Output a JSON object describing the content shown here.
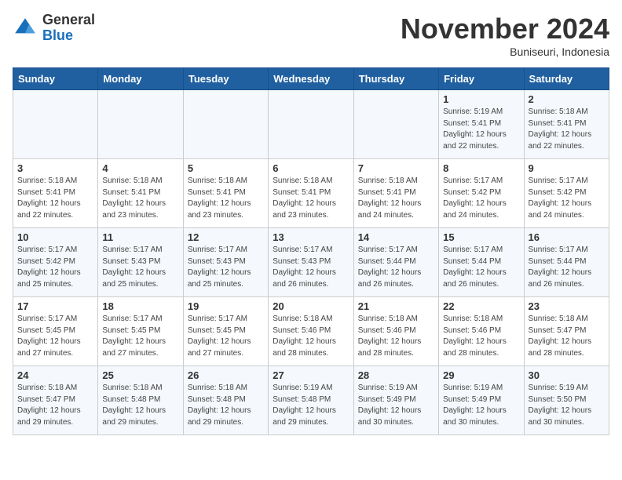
{
  "logo": {
    "general": "General",
    "blue": "Blue"
  },
  "header": {
    "month": "November 2024",
    "location": "Buniseuri, Indonesia"
  },
  "weekdays": [
    "Sunday",
    "Monday",
    "Tuesday",
    "Wednesday",
    "Thursday",
    "Friday",
    "Saturday"
  ],
  "weeks": [
    [
      {
        "day": "",
        "info": ""
      },
      {
        "day": "",
        "info": ""
      },
      {
        "day": "",
        "info": ""
      },
      {
        "day": "",
        "info": ""
      },
      {
        "day": "",
        "info": ""
      },
      {
        "day": "1",
        "info": "Sunrise: 5:19 AM\nSunset: 5:41 PM\nDaylight: 12 hours\nand 22 minutes."
      },
      {
        "day": "2",
        "info": "Sunrise: 5:18 AM\nSunset: 5:41 PM\nDaylight: 12 hours\nand 22 minutes."
      }
    ],
    [
      {
        "day": "3",
        "info": "Sunrise: 5:18 AM\nSunset: 5:41 PM\nDaylight: 12 hours\nand 22 minutes."
      },
      {
        "day": "4",
        "info": "Sunrise: 5:18 AM\nSunset: 5:41 PM\nDaylight: 12 hours\nand 23 minutes."
      },
      {
        "day": "5",
        "info": "Sunrise: 5:18 AM\nSunset: 5:41 PM\nDaylight: 12 hours\nand 23 minutes."
      },
      {
        "day": "6",
        "info": "Sunrise: 5:18 AM\nSunset: 5:41 PM\nDaylight: 12 hours\nand 23 minutes."
      },
      {
        "day": "7",
        "info": "Sunrise: 5:18 AM\nSunset: 5:41 PM\nDaylight: 12 hours\nand 24 minutes."
      },
      {
        "day": "8",
        "info": "Sunrise: 5:17 AM\nSunset: 5:42 PM\nDaylight: 12 hours\nand 24 minutes."
      },
      {
        "day": "9",
        "info": "Sunrise: 5:17 AM\nSunset: 5:42 PM\nDaylight: 12 hours\nand 24 minutes."
      }
    ],
    [
      {
        "day": "10",
        "info": "Sunrise: 5:17 AM\nSunset: 5:42 PM\nDaylight: 12 hours\nand 25 minutes."
      },
      {
        "day": "11",
        "info": "Sunrise: 5:17 AM\nSunset: 5:43 PM\nDaylight: 12 hours\nand 25 minutes."
      },
      {
        "day": "12",
        "info": "Sunrise: 5:17 AM\nSunset: 5:43 PM\nDaylight: 12 hours\nand 25 minutes."
      },
      {
        "day": "13",
        "info": "Sunrise: 5:17 AM\nSunset: 5:43 PM\nDaylight: 12 hours\nand 26 minutes."
      },
      {
        "day": "14",
        "info": "Sunrise: 5:17 AM\nSunset: 5:44 PM\nDaylight: 12 hours\nand 26 minutes."
      },
      {
        "day": "15",
        "info": "Sunrise: 5:17 AM\nSunset: 5:44 PM\nDaylight: 12 hours\nand 26 minutes."
      },
      {
        "day": "16",
        "info": "Sunrise: 5:17 AM\nSunset: 5:44 PM\nDaylight: 12 hours\nand 26 minutes."
      }
    ],
    [
      {
        "day": "17",
        "info": "Sunrise: 5:17 AM\nSunset: 5:45 PM\nDaylight: 12 hours\nand 27 minutes."
      },
      {
        "day": "18",
        "info": "Sunrise: 5:17 AM\nSunset: 5:45 PM\nDaylight: 12 hours\nand 27 minutes."
      },
      {
        "day": "19",
        "info": "Sunrise: 5:17 AM\nSunset: 5:45 PM\nDaylight: 12 hours\nand 27 minutes."
      },
      {
        "day": "20",
        "info": "Sunrise: 5:18 AM\nSunset: 5:46 PM\nDaylight: 12 hours\nand 28 minutes."
      },
      {
        "day": "21",
        "info": "Sunrise: 5:18 AM\nSunset: 5:46 PM\nDaylight: 12 hours\nand 28 minutes."
      },
      {
        "day": "22",
        "info": "Sunrise: 5:18 AM\nSunset: 5:46 PM\nDaylight: 12 hours\nand 28 minutes."
      },
      {
        "day": "23",
        "info": "Sunrise: 5:18 AM\nSunset: 5:47 PM\nDaylight: 12 hours\nand 28 minutes."
      }
    ],
    [
      {
        "day": "24",
        "info": "Sunrise: 5:18 AM\nSunset: 5:47 PM\nDaylight: 12 hours\nand 29 minutes."
      },
      {
        "day": "25",
        "info": "Sunrise: 5:18 AM\nSunset: 5:48 PM\nDaylight: 12 hours\nand 29 minutes."
      },
      {
        "day": "26",
        "info": "Sunrise: 5:18 AM\nSunset: 5:48 PM\nDaylight: 12 hours\nand 29 minutes."
      },
      {
        "day": "27",
        "info": "Sunrise: 5:19 AM\nSunset: 5:48 PM\nDaylight: 12 hours\nand 29 minutes."
      },
      {
        "day": "28",
        "info": "Sunrise: 5:19 AM\nSunset: 5:49 PM\nDaylight: 12 hours\nand 30 minutes."
      },
      {
        "day": "29",
        "info": "Sunrise: 5:19 AM\nSunset: 5:49 PM\nDaylight: 12 hours\nand 30 minutes."
      },
      {
        "day": "30",
        "info": "Sunrise: 5:19 AM\nSunset: 5:50 PM\nDaylight: 12 hours\nand 30 minutes."
      }
    ]
  ]
}
